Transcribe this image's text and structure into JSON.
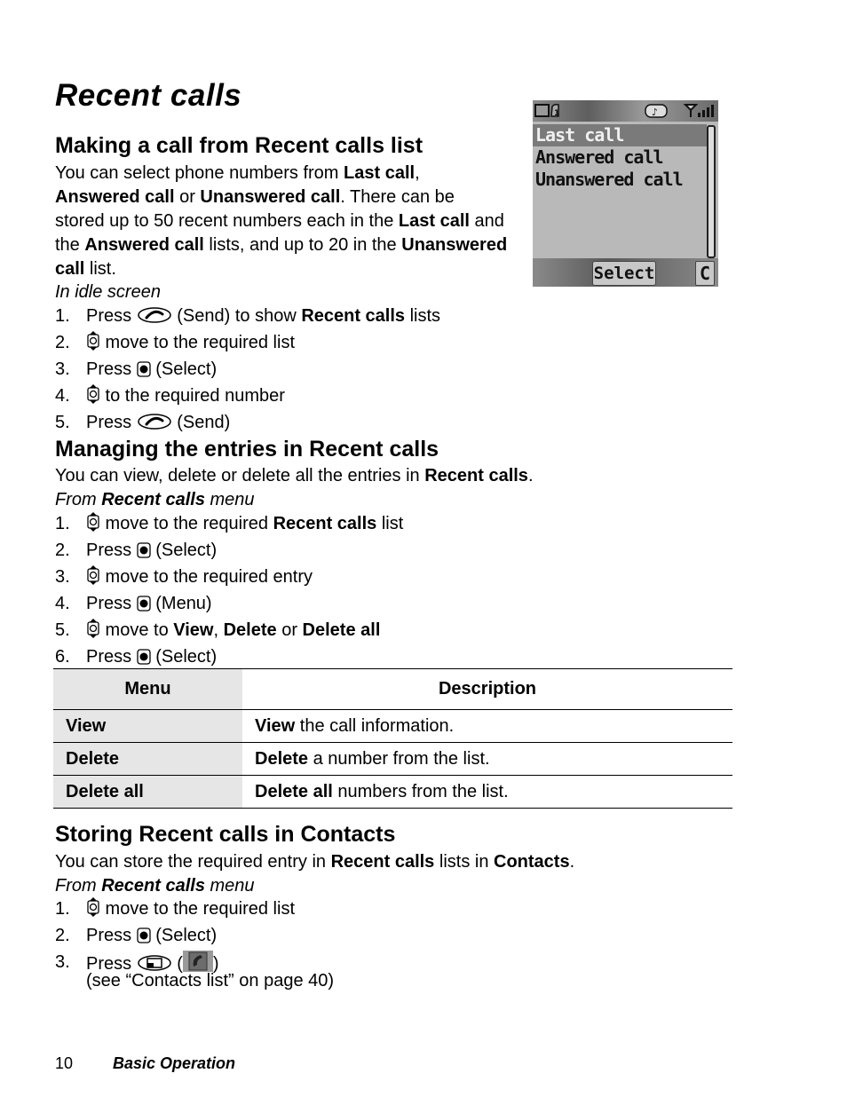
{
  "page": {
    "title": "Recent calls",
    "footer": {
      "page_number": "10",
      "section": "Basic Operation"
    }
  },
  "phone_screen": {
    "status_icons": [
      "battery-icon",
      "line1-icon",
      "ringer-icon",
      "signal-icon"
    ],
    "items": [
      "Last call",
      "Answered call",
      "Unanswered call"
    ],
    "selected_index": 0,
    "softkey_select": "Select",
    "softkey_clear": "C"
  },
  "section1": {
    "heading": "Making a call from Recent calls list",
    "intro": [
      {
        "t": "You can select phone numbers from "
      },
      {
        "b": "Last call"
      },
      {
        "t": ", "
      },
      {
        "b": "Answered call"
      },
      {
        "t": " or "
      },
      {
        "b": "Unanswered call"
      },
      {
        "t": ". There can be stored up to 50 recent numbers each in the "
      },
      {
        "b": "Last call"
      },
      {
        "t": " and the "
      },
      {
        "b": "Answered call"
      },
      {
        "t": " lists, and up to 20 in the "
      },
      {
        "b": "Unanswered call"
      },
      {
        "t": " list."
      }
    ],
    "context": "In idle screen",
    "steps": [
      {
        "n": "1.",
        "parts": [
          {
            "t": "Press "
          },
          {
            "icon": "send-key"
          },
          {
            "t": " (Send) to show "
          },
          {
            "b": "Recent calls"
          },
          {
            "t": " lists"
          }
        ]
      },
      {
        "n": "2.",
        "parts": [
          {
            "icon": "nav-key"
          },
          {
            "t": " move to the required list"
          }
        ]
      },
      {
        "n": "3.",
        "parts": [
          {
            "t": "Press "
          },
          {
            "icon": "select-key"
          },
          {
            "t": " (Select)"
          }
        ]
      },
      {
        "n": "4.",
        "parts": [
          {
            "icon": "nav-key"
          },
          {
            "t": " to the required number"
          }
        ]
      },
      {
        "n": "5.",
        "parts": [
          {
            "t": "Press "
          },
          {
            "icon": "send-key"
          },
          {
            "t": " (Send)"
          }
        ]
      }
    ]
  },
  "section2": {
    "heading": "Managing the entries in Recent calls",
    "intro": [
      {
        "t": "You can view, delete or delete all the entries in "
      },
      {
        "b": "Recent calls"
      },
      {
        "t": "."
      }
    ],
    "context": [
      {
        "t": "From "
      },
      {
        "b": "Recent calls"
      },
      {
        "t": " menu"
      }
    ],
    "steps": [
      {
        "n": "1.",
        "parts": [
          {
            "icon": "nav-key"
          },
          {
            "t": " move to the required "
          },
          {
            "b": "Recent calls"
          },
          {
            "t": " list"
          }
        ]
      },
      {
        "n": "2.",
        "parts": [
          {
            "t": "Press "
          },
          {
            "icon": "select-key"
          },
          {
            "t": " (Select)"
          }
        ]
      },
      {
        "n": "3.",
        "parts": [
          {
            "icon": "nav-key"
          },
          {
            "t": " move to the required entry"
          }
        ]
      },
      {
        "n": "4.",
        "parts": [
          {
            "t": "Press "
          },
          {
            "icon": "select-key"
          },
          {
            "t": " (Menu)"
          }
        ]
      },
      {
        "n": "5.",
        "parts": [
          {
            "icon": "nav-key"
          },
          {
            "t": " move to "
          },
          {
            "b": "View"
          },
          {
            "t": ", "
          },
          {
            "b": "Delete"
          },
          {
            "t": " or "
          },
          {
            "b": "Delete all"
          }
        ]
      },
      {
        "n": "6.",
        "parts": [
          {
            "t": "Press "
          },
          {
            "icon": "select-key"
          },
          {
            "t": " (Select)"
          }
        ]
      }
    ],
    "table": {
      "headers": [
        "Menu",
        "Description"
      ],
      "rows": [
        {
          "menu": "View",
          "desc_bold": "View",
          "desc_rest": " the call information."
        },
        {
          "menu": "Delete",
          "desc_bold": "Delete",
          "desc_rest": " a number from the list."
        },
        {
          "menu": "Delete all",
          "desc_bold": "Delete all",
          "desc_rest": " numbers from the list."
        }
      ]
    }
  },
  "section3": {
    "heading": "Storing Recent calls in Contacts",
    "intro": [
      {
        "t": "You can store the required entry in "
      },
      {
        "b": "Recent calls"
      },
      {
        "t": " lists in "
      },
      {
        "b": "Contacts"
      },
      {
        "t": "."
      }
    ],
    "context": [
      {
        "t": "From "
      },
      {
        "b": "Recent calls"
      },
      {
        "t": " menu"
      }
    ],
    "steps": [
      {
        "n": "1.",
        "parts": [
          {
            "icon": "nav-key"
          },
          {
            "t": " move to the required list"
          }
        ]
      },
      {
        "n": "2.",
        "parts": [
          {
            "t": "Press "
          },
          {
            "icon": "select-key"
          },
          {
            "t": " (Select)"
          }
        ]
      },
      {
        "n": "3.",
        "parts": [
          {
            "t": "Press "
          },
          {
            "icon": "soft-key"
          },
          {
            "t": " ("
          },
          {
            "icon": "contacts-save"
          },
          {
            "t": ")"
          }
        ]
      }
    ],
    "note": "(see “Contacts list” on page 40)"
  }
}
